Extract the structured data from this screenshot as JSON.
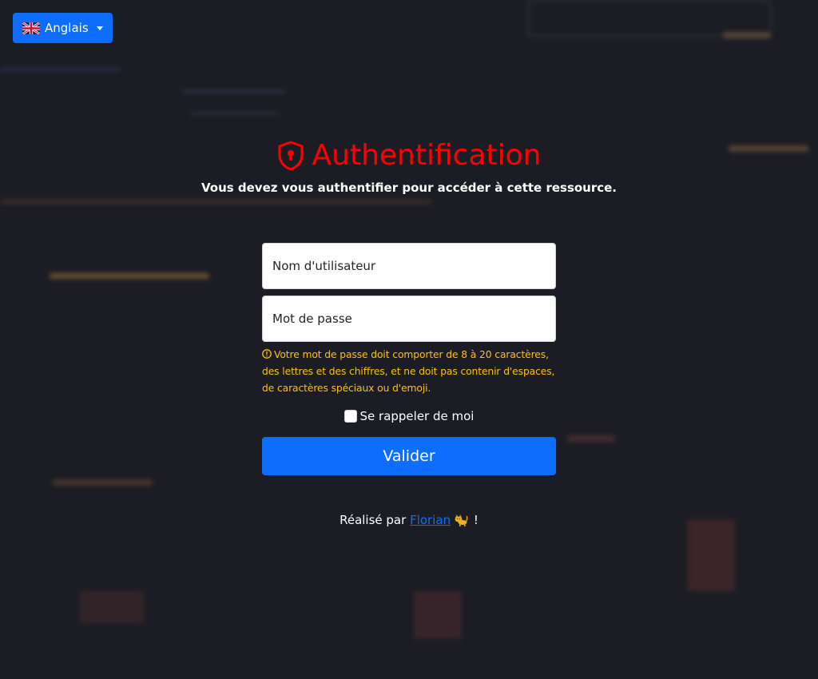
{
  "language_button": {
    "label": "Anglais",
    "flag_icon": "uk-flag-icon"
  },
  "header": {
    "icon": "shield-lock-icon",
    "title": "Authentification",
    "subtitle": "Vous devez vous authentifier pour accéder à cette ressource."
  },
  "form": {
    "username_placeholder": "Nom d'utilisateur",
    "username_value": "",
    "password_placeholder": "Mot de passe",
    "password_value": "",
    "password_hint": "Votre mot de passe doit comporter de 8 à 20 caractères, des lettres et des chiffres, et ne doit pas contenir d'espaces, de caractères spéciaux ou d'emoji.",
    "remember_label": "Se rappeler de moi",
    "remember_checked": false,
    "submit_label": "Valider"
  },
  "footer": {
    "prefix": "Réalisé par",
    "author_link": "Florian",
    "suffix": "!",
    "emoji_icon": "cat-icon"
  },
  "colors": {
    "background": "#1c1d24",
    "accent": "#0d6efd",
    "title": "#ff0000",
    "warning": "#ffc107"
  }
}
